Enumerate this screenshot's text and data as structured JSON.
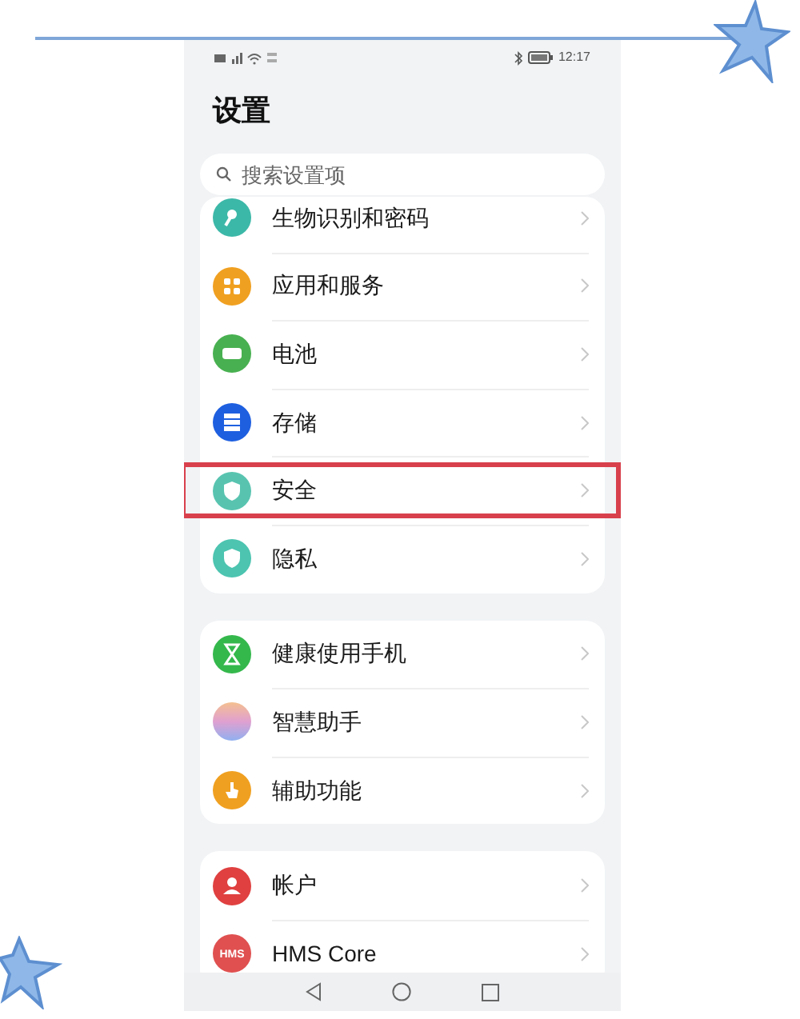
{
  "status_bar": {
    "time": "12:17"
  },
  "title": "设置",
  "search": {
    "placeholder": "搜索设置项"
  },
  "groups": [
    {
      "items": [
        {
          "label": "生物识别和密码",
          "kind": "key",
          "color": "#3cb8a8",
          "highlighted": false
        },
        {
          "label": "应用和服务",
          "kind": "grid",
          "color": "#f0a020",
          "highlighted": false
        },
        {
          "label": "电池",
          "kind": "battery",
          "color": "#48b050",
          "highlighted": false
        },
        {
          "label": "存储",
          "kind": "storage",
          "color": "#1e5fe0",
          "highlighted": false
        },
        {
          "label": "安全",
          "kind": "shield",
          "color": "#58c4b0",
          "highlighted": true
        },
        {
          "label": "隐私",
          "kind": "shield",
          "color": "#4cc4b0",
          "highlighted": false
        }
      ]
    },
    {
      "items": [
        {
          "label": "健康使用手机",
          "kind": "hourglass",
          "color": "#34b84c",
          "highlighted": false
        },
        {
          "label": "智慧助手",
          "kind": "gradient",
          "color": "#e0a0d0",
          "highlighted": false
        },
        {
          "label": "辅助功能",
          "kind": "hand",
          "color": "#f0a020",
          "highlighted": false
        }
      ]
    },
    {
      "items": [
        {
          "label": "帐户",
          "kind": "person",
          "color": "#e04040",
          "highlighted": false
        },
        {
          "label": "HMS Core",
          "kind": "text",
          "icon_text": "HMS",
          "color": "#e05050",
          "highlighted": false
        }
      ]
    }
  ]
}
